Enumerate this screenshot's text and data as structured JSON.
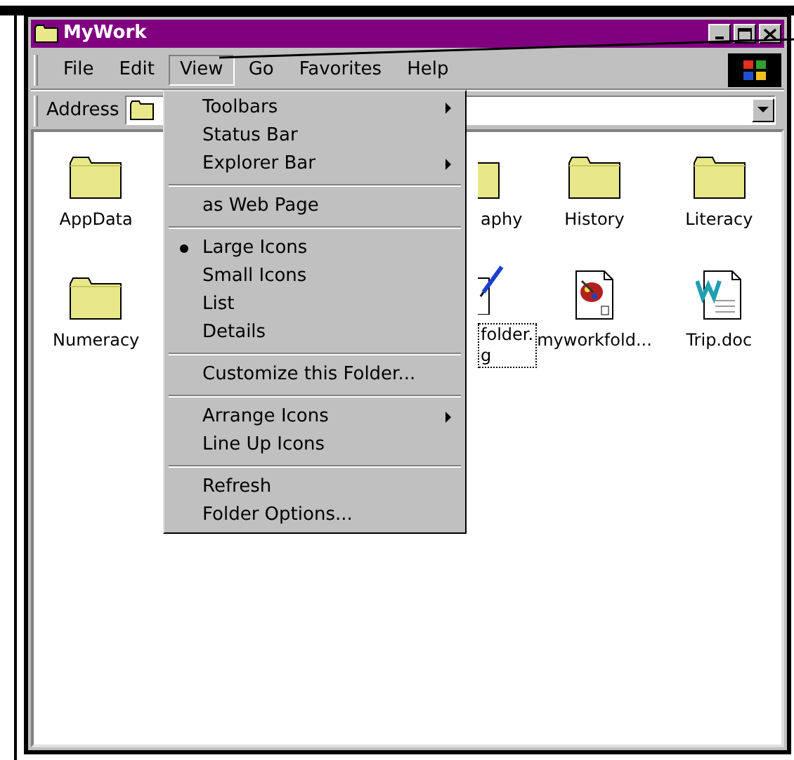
{
  "window": {
    "title": "MyWork"
  },
  "menu_bar": [
    {
      "label": "File",
      "selected": false
    },
    {
      "label": "Edit",
      "selected": false
    },
    {
      "label": "View",
      "selected": true
    },
    {
      "label": "Go",
      "selected": false
    },
    {
      "label": "Favorites",
      "selected": false
    },
    {
      "label": "Help",
      "selected": false
    }
  ],
  "address_bar": {
    "label": "Address"
  },
  "view_menu": [
    {
      "kind": "item",
      "label": "Toolbars",
      "checked": false,
      "submenu": true
    },
    {
      "kind": "item",
      "label": "Status Bar",
      "checked": false,
      "submenu": false
    },
    {
      "kind": "item",
      "label": "Explorer Bar",
      "checked": false,
      "submenu": true
    },
    {
      "kind": "separator"
    },
    {
      "kind": "item",
      "label": "as Web Page",
      "checked": false,
      "submenu": false
    },
    {
      "kind": "separator"
    },
    {
      "kind": "item",
      "label": "Large Icons",
      "checked": true,
      "submenu": false
    },
    {
      "kind": "item",
      "label": "Small Icons",
      "checked": false,
      "submenu": false
    },
    {
      "kind": "item",
      "label": "List",
      "checked": false,
      "submenu": false
    },
    {
      "kind": "item",
      "label": "Details",
      "checked": false,
      "submenu": false
    },
    {
      "kind": "separator"
    },
    {
      "kind": "item",
      "label": "Customize this Folder...",
      "checked": false,
      "submenu": false
    },
    {
      "kind": "separator"
    },
    {
      "kind": "item",
      "label": "Arrange Icons",
      "checked": false,
      "submenu": true
    },
    {
      "kind": "item",
      "label": "Line Up Icons",
      "checked": false,
      "submenu": false
    },
    {
      "kind": "separator"
    },
    {
      "kind": "item",
      "label": "Refresh",
      "checked": false,
      "submenu": false
    },
    {
      "kind": "item",
      "label": "Folder Options...",
      "checked": false,
      "submenu": false
    }
  ],
  "icon_rows": [
    [
      {
        "label": "AppData",
        "kind": "folder",
        "selected": false
      },
      {
        "label": "aphy",
        "kind": "folder_clipped",
        "selected": false
      },
      {
        "label": "History",
        "kind": "folder",
        "selected": false
      },
      {
        "label": "Literacy",
        "kind": "folder",
        "selected": false
      }
    ],
    [
      {
        "label": "Numeracy",
        "kind": "folder",
        "selected": false
      },
      {
        "label": "folder.\ng",
        "kind": "drawing_clipped",
        "selected": true
      },
      {
        "label": "myworkfold...",
        "kind": "paint",
        "selected": false
      },
      {
        "label": "Trip.doc",
        "kind": "word",
        "selected": false
      }
    ]
  ]
}
